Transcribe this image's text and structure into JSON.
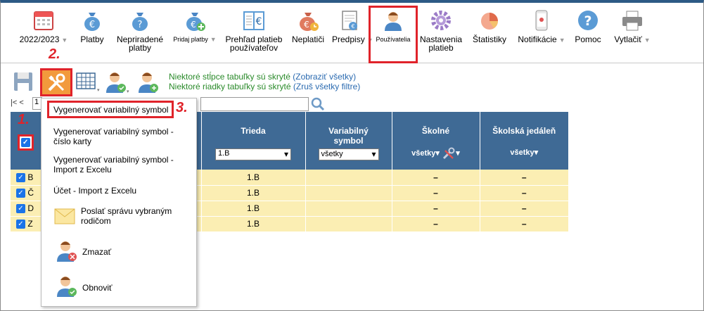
{
  "toolbar": {
    "items": [
      {
        "label": "2022/2023",
        "has_arrow": true
      },
      {
        "label": "Platby"
      },
      {
        "label": "Nepriradené platby"
      },
      {
        "label": "Pridaj platby",
        "has_arrow": true
      },
      {
        "label": "Prehľad platieb používateľov"
      },
      {
        "label": "Neplatiči"
      },
      {
        "label": "Predpisy",
        "has_arrow": true
      },
      {
        "label": "Používatelia"
      },
      {
        "label": "Nastavenia platieb"
      },
      {
        "label": "Štatistiky"
      },
      {
        "label": "Notifikácie",
        "has_arrow": true
      },
      {
        "label": "Pomoc"
      },
      {
        "label": "Vytlačiť",
        "has_arrow": true
      }
    ]
  },
  "annotations": {
    "step1": "1.",
    "step2": "2.",
    "step3": "3."
  },
  "notes": {
    "columns_hidden": "Niektoré stĺpce tabuľky sú skryté",
    "show_all": "(Zobraziť všetky)",
    "rows_hidden": "Niektoré riadky tabuľky sú skryté",
    "cancel_filters": "(Zruš všetky filtre)"
  },
  "pager": {
    "first": "|<",
    "prev": "<",
    "page": "1"
  },
  "table": {
    "headers": {
      "trieda": "Trieda",
      "variabilny": "Variabilný symbol",
      "skolne": "Školné",
      "jedalen": "Školská jedáleň"
    },
    "filters": {
      "trieda": "1.B",
      "variabilny": "všetky",
      "skolne": "všetky",
      "jedalen": "všetky"
    },
    "rows": [
      {
        "initial": "B",
        "trieda": "1.B",
        "skolne": "–",
        "jedalen": "–"
      },
      {
        "initial": "Č",
        "trieda": "1.B",
        "skolne": "–",
        "jedalen": "–"
      },
      {
        "initial": "D",
        "trieda": "1.B",
        "skolne": "–",
        "jedalen": "–"
      },
      {
        "initial": "Z",
        "trieda": "1.B",
        "skolne": "–",
        "jedalen": "–"
      }
    ]
  },
  "menu": {
    "item1": "Vygenerovať variabilný symbol",
    "item2": "Vygenerovať variabilný symbol - číslo karty",
    "item3": "Vygenerovať variabilný symbol - Import z Excelu",
    "item4": "Účet - Import z Excelu",
    "item5": "Poslať správu vybraným rodičom",
    "item6": "Zmazať",
    "item7": "Obnoviť"
  },
  "colors": {
    "header_bg": "#3f6a95",
    "row_bg": "#fbeeb3",
    "highlight": "#e0232a",
    "note_green": "#2a8a2a"
  }
}
